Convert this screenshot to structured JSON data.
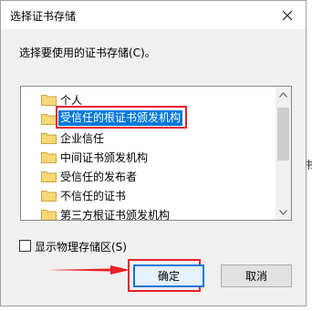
{
  "background": {
    "partial_text": "书"
  },
  "dialog": {
    "title": "选择证书存储",
    "instruction": "选择要使用的证书存储(C)。",
    "tree_items": [
      {
        "label": "个人",
        "selected": false
      },
      {
        "label": "受信任的根证书颁发机构",
        "selected": true
      },
      {
        "label": "企业信任",
        "selected": false
      },
      {
        "label": "中间证书颁发机构",
        "selected": false
      },
      {
        "label": "受信任的发布者",
        "selected": false
      },
      {
        "label": "不信任的证书",
        "selected": false
      },
      {
        "label": "第三方根证书颁发机构",
        "selected": false
      }
    ],
    "show_physical_label": "显示物理存储区(S)",
    "show_physical_checked": false,
    "ok_label": "确定",
    "cancel_label": "取消"
  },
  "icons": {
    "close": "close-icon",
    "folder": "folder-icon",
    "scroll_up": "chevron-up-icon",
    "scroll_down": "chevron-down-icon",
    "arrow": "arrow-right-icon"
  },
  "colors": {
    "selection": "#0078d7",
    "annotation_red": "#e81e25",
    "folder": "#f8d775",
    "dialog_bg": "#f0f0f0"
  }
}
